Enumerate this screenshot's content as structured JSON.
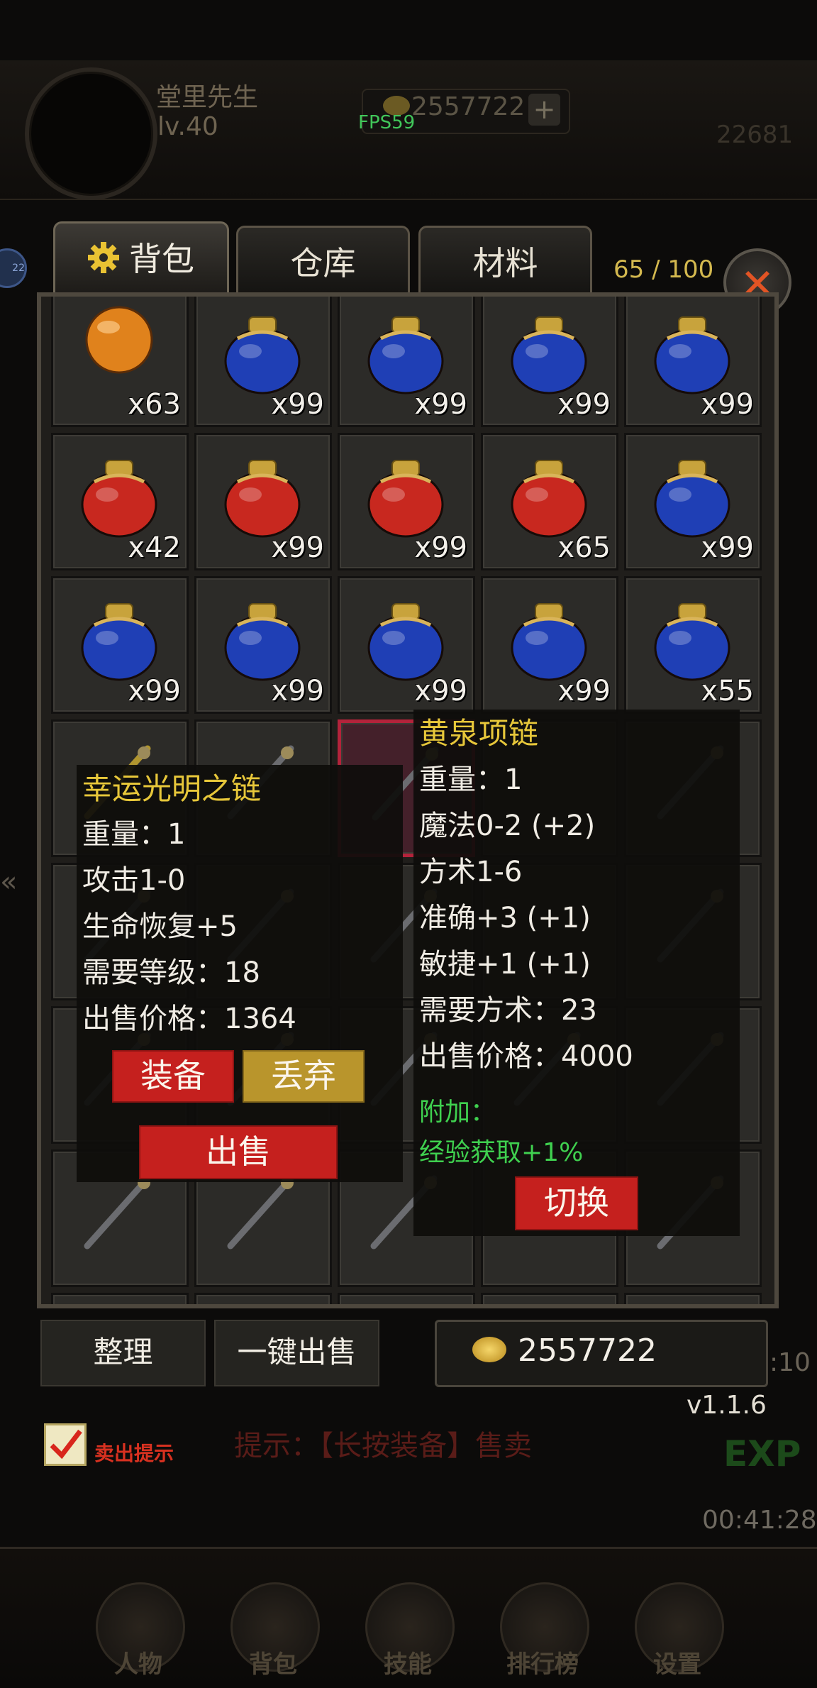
{
  "player": {
    "name": "堂里先生",
    "level": "lv.40"
  },
  "top": {
    "gold": "2557722",
    "plus": "+",
    "fps": "FPS59",
    "side_number": "22681",
    "side_badge": "22"
  },
  "tabs": {
    "bag": "背包",
    "storage": "仓库",
    "materials": "材料"
  },
  "bag_count": "65 / 100",
  "close": "✕",
  "inventory": {
    "rows": [
      [
        "x63",
        "x99",
        "x99",
        "x99",
        "x99"
      ],
      [
        "x42",
        "x99",
        "x99",
        "x65",
        "x99"
      ],
      [
        "x99",
        "x99",
        "x99",
        "x99",
        "x55"
      ]
    ]
  },
  "tooltip_left": {
    "title": "幸运光明之链",
    "lines": [
      "重量：1",
      "攻击1-0",
      "生命恢复+5",
      "需要等级：18",
      "出售价格：1364"
    ],
    "equip": "装备",
    "discard": "丢弃",
    "sell": "出售"
  },
  "tooltip_right": {
    "title": "黄泉项链",
    "lines": [
      "重量：1",
      "魔法0-2 (+2)",
      "方术1-6",
      "准确+3 (+1)",
      "敏捷+1 (+1)",
      "需要方术：23",
      "出售价格：4000"
    ],
    "extra_label": "附加：",
    "extra_line": "经验获取+1%",
    "switch": "切换"
  },
  "bottom": {
    "sort": "整理",
    "sell_all": "一键出售",
    "gold": "2557722",
    "version": "v1.1.6",
    "sell_hint_label": "卖出提示",
    "hint": "提示：【长按装备】售卖",
    "exp": "EXP",
    "timer": "00:41:28",
    "side_time": ":10"
  },
  "nav": [
    "人物",
    "背包",
    "技能",
    "排行榜",
    "设置"
  ],
  "colors": {
    "red_potion": "#c8281f",
    "blue_potion": "#1f3fb5",
    "gold_text": "#e7c73a",
    "accent_red": "#c5201e"
  }
}
